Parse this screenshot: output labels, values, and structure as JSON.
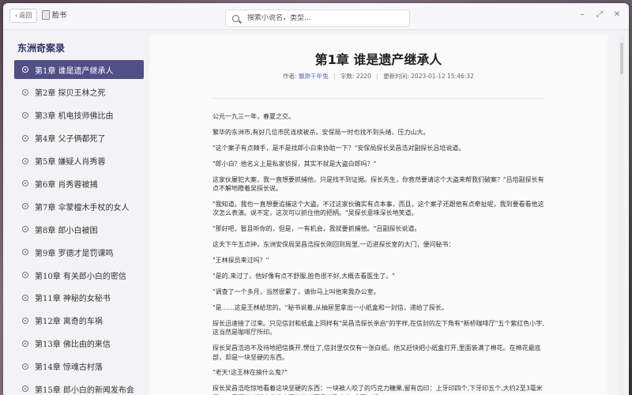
{
  "window": {
    "back_label": "返回",
    "app_title": "脸书",
    "search_placeholder": "搜索小说名，类型..."
  },
  "sidebar": {
    "book_title": "东洲奇案录",
    "chapters": [
      {
        "label": "第1章 谁是遗产继承人",
        "active": true
      },
      {
        "label": "第2章 探贝王林之死",
        "active": false
      },
      {
        "label": "第3章 机电技师佛比由",
        "active": false
      },
      {
        "label": "第4章 父子俩都死了",
        "active": false
      },
      {
        "label": "第5章 嫌疑人肖秀蓉",
        "active": false
      },
      {
        "label": "第6章 肖秀蓉被捕",
        "active": false
      },
      {
        "label": "第7章 伞蒙檀木手杖的女人",
        "active": false
      },
      {
        "label": "第8章 郎小白被困",
        "active": false
      },
      {
        "label": "第9章 罗德才是罚课鸣",
        "active": false
      },
      {
        "label": "第10章 有关郎小白的密信",
        "active": false
      },
      {
        "label": "第11章 神秘的女秘书",
        "active": false
      },
      {
        "label": "第12章 离奇的车祸",
        "active": false
      },
      {
        "label": "第13章 佛比由的来信",
        "active": false
      },
      {
        "label": "第14章 惊魂古村落",
        "active": false
      },
      {
        "label": "第15章 郎小白的新闻发布会",
        "active": false
      }
    ]
  },
  "content": {
    "heading": "第1章 谁是遗产继承人",
    "meta": {
      "author_label": "作者:",
      "author": "飘渺千年兔",
      "words_label": "字数:",
      "words": "2220",
      "updated_label": "更新时间:",
      "updated": "2023-01-12 15:46:32"
    },
    "paragraphs": [
      "公元一九三一年，春夏之交。",
      "繁华的东洲市,有好几位市民连续被杀。安保局一时也找不到头绪，压力山大。",
      "\"这个案子有点棘手，是不是找郎小白来协助一下？\"安保局探长吴昌浩对副探长吕培说道。",
      "\"郎小白？他名义上是私家侦探，其实不就是大盗白郎吗？\"",
      "这家伙屡犯大案，我一直想要抓捕他，只是找不到证据。探长先生，你竟然要请这个大盗来帮我们破案？\"吕培副探长有点不解地瞪着吴探长说。",
      "\"我知道。我也一直想要追捕这个大盗。不过这家伙确实有点本事，而且，这个案子还跟他有点牵扯呢，我到要看看他这次怎么表演。说不定，这次可以抓住他的把柄。\"吴探长意味深长地笑道。",
      "\"那好吧，暂且听你的，但是，一有机会，我就要抓捕他。\"吕副探长说道。",
      "这天下午五点钟，东洲安保局吴昌浩探长刚回到局里,一迈进探长室的大门，便问秘书：",
      "\"王林探员来过吗？\"",
      "\"是的,来过了。他好像有点不舒服,脸色很不好,大概去看医生了。\"",
      "\"调查了一个多月，当然很累了，请你马上叫他来我办公室。",
      "\"是……这是王林给您的。\"秘书说着,从抽屉里拿出一小纸盒和一封信，递给了探长。",
      "探长迅速接了过来。只见信封和纸盒上同样有\"吴昌浩探长亲启\"的字样,在信封的左下角有\"新桥咖啡厅\"五个紫红色小字,这当然是咖啡厅所印。",
      "探长吴昌浩迫不及待地把信撕开,愣住了,信封里仅仅有一张白纸。他又赶快把小纸盒打开,里面装满了棉花。在棉花最底部，却是一块坚硬的东西。",
      "\"老天!这王林在搞什么鬼?\"",
      "探长吴昌浩吃惊地看着这块坚硬的东西：一块被人咬了的巧克力糖果,留有齿印：上牙印四个,下牙印五个,大约2至3毫米深。一看便可以断定出此人牙齿不大而且不整齐,如犬牙一般。"
    ]
  }
}
